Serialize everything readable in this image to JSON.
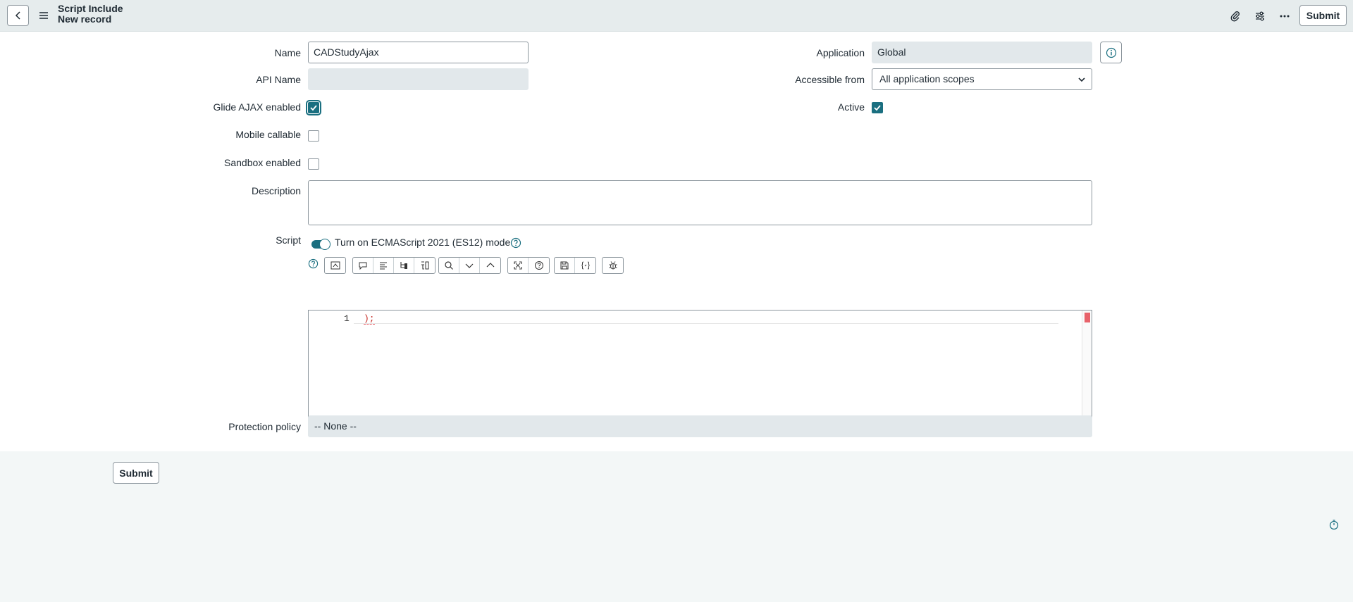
{
  "header": {
    "title": "Script Include",
    "subtitle": "New record",
    "submit_label": "Submit"
  },
  "icons": {
    "back": "chevron-left-icon",
    "menu": "hamburger-menu-icon",
    "attach": "paperclip-icon",
    "settings": "sliders-icon",
    "more": "more-options-icon",
    "info": "info-icon",
    "help": "help-icon",
    "timer": "timer-icon"
  },
  "form": {
    "name": {
      "label": "Name",
      "value": "CADStudyAjax"
    },
    "api_name": {
      "label": "API Name",
      "value": ""
    },
    "application": {
      "label": "Application",
      "value": "Global"
    },
    "accessible_from": {
      "label": "Accessible from",
      "value": "All application scopes"
    },
    "glide_ajax": {
      "label": "Glide AJAX enabled",
      "checked": true
    },
    "active": {
      "label": "Active",
      "checked": true
    },
    "mobile_callable": {
      "label": "Mobile callable",
      "checked": false
    },
    "sandbox_enabled": {
      "label": "Sandbox enabled",
      "checked": false
    },
    "description": {
      "label": "Description",
      "value": ""
    },
    "script": {
      "label": "Script",
      "es_mode_label": "Turn on ECMAScript 2021 (ES12) mode",
      "es_mode_on": true,
      "line_number": "1",
      "code": ");"
    },
    "protection_policy": {
      "label": "Protection policy",
      "value": "-- None --"
    }
  },
  "footer": {
    "submit_label": "Submit"
  },
  "colors": {
    "accent": "#1a6f80",
    "header_bg": "#e6eced",
    "readonly_bg": "#e2e8eb",
    "error_mark": "#e8636b"
  }
}
